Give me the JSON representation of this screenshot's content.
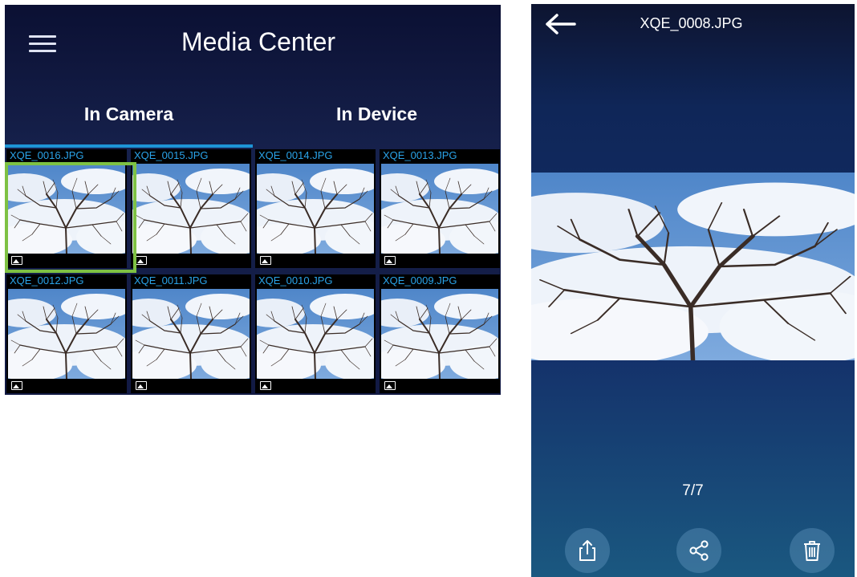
{
  "media_center": {
    "title": "Media Center",
    "tabs": [
      {
        "label": "In Camera",
        "active": true
      },
      {
        "label": "In Device",
        "active": false
      }
    ],
    "thumbnails": [
      {
        "label": "XQE_0016.JPG",
        "selected": true
      },
      {
        "label": "XQE_0015.JPG",
        "selected": false
      },
      {
        "label": "XQE_0014.JPG",
        "selected": false
      },
      {
        "label": "XQE_0013.JPG",
        "selected": false
      },
      {
        "label": "XQE_0012.JPG",
        "selected": false
      },
      {
        "label": "XQE_0011.JPG",
        "selected": false
      },
      {
        "label": "XQE_0010.JPG",
        "selected": false
      },
      {
        "label": "XQE_0009.JPG",
        "selected": false
      }
    ],
    "colors": {
      "accent": "#1e95d6",
      "label": "#2aa3e8",
      "selection": "#7ec143"
    },
    "icons": {
      "menu": "menu-icon",
      "thumbnail_type": "image-icon"
    }
  },
  "viewer": {
    "title": "XQE_0008.JPG",
    "counter": "7/7",
    "icons": {
      "back": "back-arrow-icon",
      "export": "export-icon",
      "share": "share-icon",
      "delete": "trash-icon"
    }
  }
}
